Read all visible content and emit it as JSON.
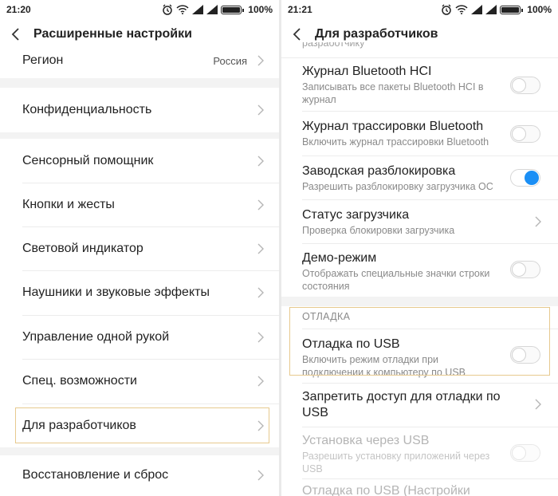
{
  "left": {
    "status": {
      "time": "21:20",
      "battery": "100%"
    },
    "header": {
      "title": "Расширенные настройки"
    },
    "region": {
      "label": "Регион",
      "value": "Россия"
    },
    "items": [
      {
        "label": "Конфиденциальность"
      },
      {
        "label": "Сенсорный помощник"
      },
      {
        "label": "Кнопки и жесты"
      },
      {
        "label": "Световой индикатор"
      },
      {
        "label": "Наушники и звуковые эффекты"
      },
      {
        "label": "Управление одной рукой"
      },
      {
        "label": "Спец. возможности"
      },
      {
        "label": "Для разработчиков"
      },
      {
        "label": "Восстановление и сброс"
      }
    ]
  },
  "right": {
    "status": {
      "time": "21:21",
      "battery": "100%"
    },
    "header": {
      "title": "Для разработчиков"
    },
    "cut_top": "разработчику",
    "items": [
      {
        "title": "Журнал Bluetooth HCI",
        "subtitle": "Записывать все пакеты Bluetooth HCI в журнал",
        "control": "toggle",
        "on": false
      },
      {
        "title": "Журнал трассировки Bluetooth",
        "subtitle": "Включить журнал трассировки Bluetooth",
        "control": "toggle",
        "on": false
      },
      {
        "title": "Заводская разблокировка",
        "subtitle": "Разрешить разблокировку загрузчика ОС",
        "control": "toggle",
        "on": true
      },
      {
        "title": "Статус загрузчика",
        "subtitle": "Проверка блокировки загрузчика",
        "control": "chevron"
      },
      {
        "title": "Демо-режим",
        "subtitle": "Отображать специальные значки строки состояния",
        "control": "toggle",
        "on": false
      }
    ],
    "section": {
      "label": "ОТЛАДКА"
    },
    "debug_items": [
      {
        "title": "Отладка по USB",
        "subtitle": "Включить режим отладки при подключении к компьютеру по USB",
        "control": "toggle",
        "on": false
      },
      {
        "title": "Запретить доступ для отладки по USB",
        "control": "chevron"
      },
      {
        "title": "Установка через USB",
        "subtitle": "Разрешить установку приложений через USB",
        "control": "toggle",
        "on": false,
        "disabled": true
      },
      {
        "title": "Отладка по USB (Настройки"
      }
    ]
  },
  "colors": {
    "accent": "#1b8ff5",
    "highlight": "#e7c98e",
    "divider": "#ececec",
    "gap": "#f3f3f3"
  }
}
